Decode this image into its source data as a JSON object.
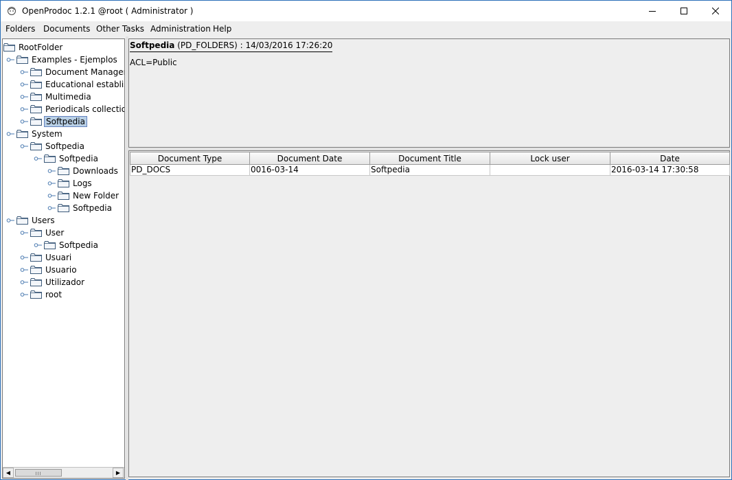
{
  "window": {
    "title": "OpenProdoc 1.2.1 @root ( Administrator )",
    "icon": "openprodoc-app-icon",
    "controls": [
      "minimize-icon",
      "maximize-icon",
      "close-icon"
    ]
  },
  "menu": {
    "items": [
      "Folders",
      "Documents",
      "Other Tasks",
      "Administration",
      "Help"
    ]
  },
  "tree": {
    "nodes": [
      {
        "label": "RootFolder",
        "level": 0
      },
      {
        "label": "Examples - Ejemplos",
        "level": 1
      },
      {
        "label": "Document Managem",
        "level": 2
      },
      {
        "label": "Educational establish",
        "level": 2
      },
      {
        "label": "Multimedia",
        "level": 2
      },
      {
        "label": "Periodicals collection",
        "level": 2
      },
      {
        "label": "Softpedia",
        "level": 2,
        "selected": true
      },
      {
        "label": "System",
        "level": 1
      },
      {
        "label": "Softpedia",
        "level": 2
      },
      {
        "label": "Softpedia",
        "level": 3
      },
      {
        "label": "Downloads",
        "level": 4
      },
      {
        "label": "Logs",
        "level": 4
      },
      {
        "label": "New Folder",
        "level": 4
      },
      {
        "label": "Softpedia",
        "level": 4
      },
      {
        "label": "Users",
        "level": 1
      },
      {
        "label": "User",
        "level": 2
      },
      {
        "label": "Softpedia",
        "level": 3
      },
      {
        "label": "Usuari",
        "level": 2
      },
      {
        "label": "Usuario",
        "level": 2
      },
      {
        "label": "Utilizador",
        "level": 2
      },
      {
        "label": "root",
        "level": 2
      }
    ]
  },
  "info": {
    "folder_name": "Softpedia",
    "folder_meta": " (PD_FOLDERS) : 14/03/2016 17:26:20",
    "acl": "ACL=Public"
  },
  "table": {
    "columns": [
      "Document Type",
      "Document Date",
      "Document Title",
      "Lock user",
      "Date"
    ],
    "rows": [
      [
        "PD_DOCS",
        "0016-03-14",
        "Softpedia",
        "",
        "2016-03-14 17:30:58"
      ]
    ]
  },
  "colors": {
    "selection_bg": "#b8cfe5",
    "selection_border": "#6382bf",
    "window_border": "#2b6fb8",
    "panel_bg": "#eeeeee"
  }
}
